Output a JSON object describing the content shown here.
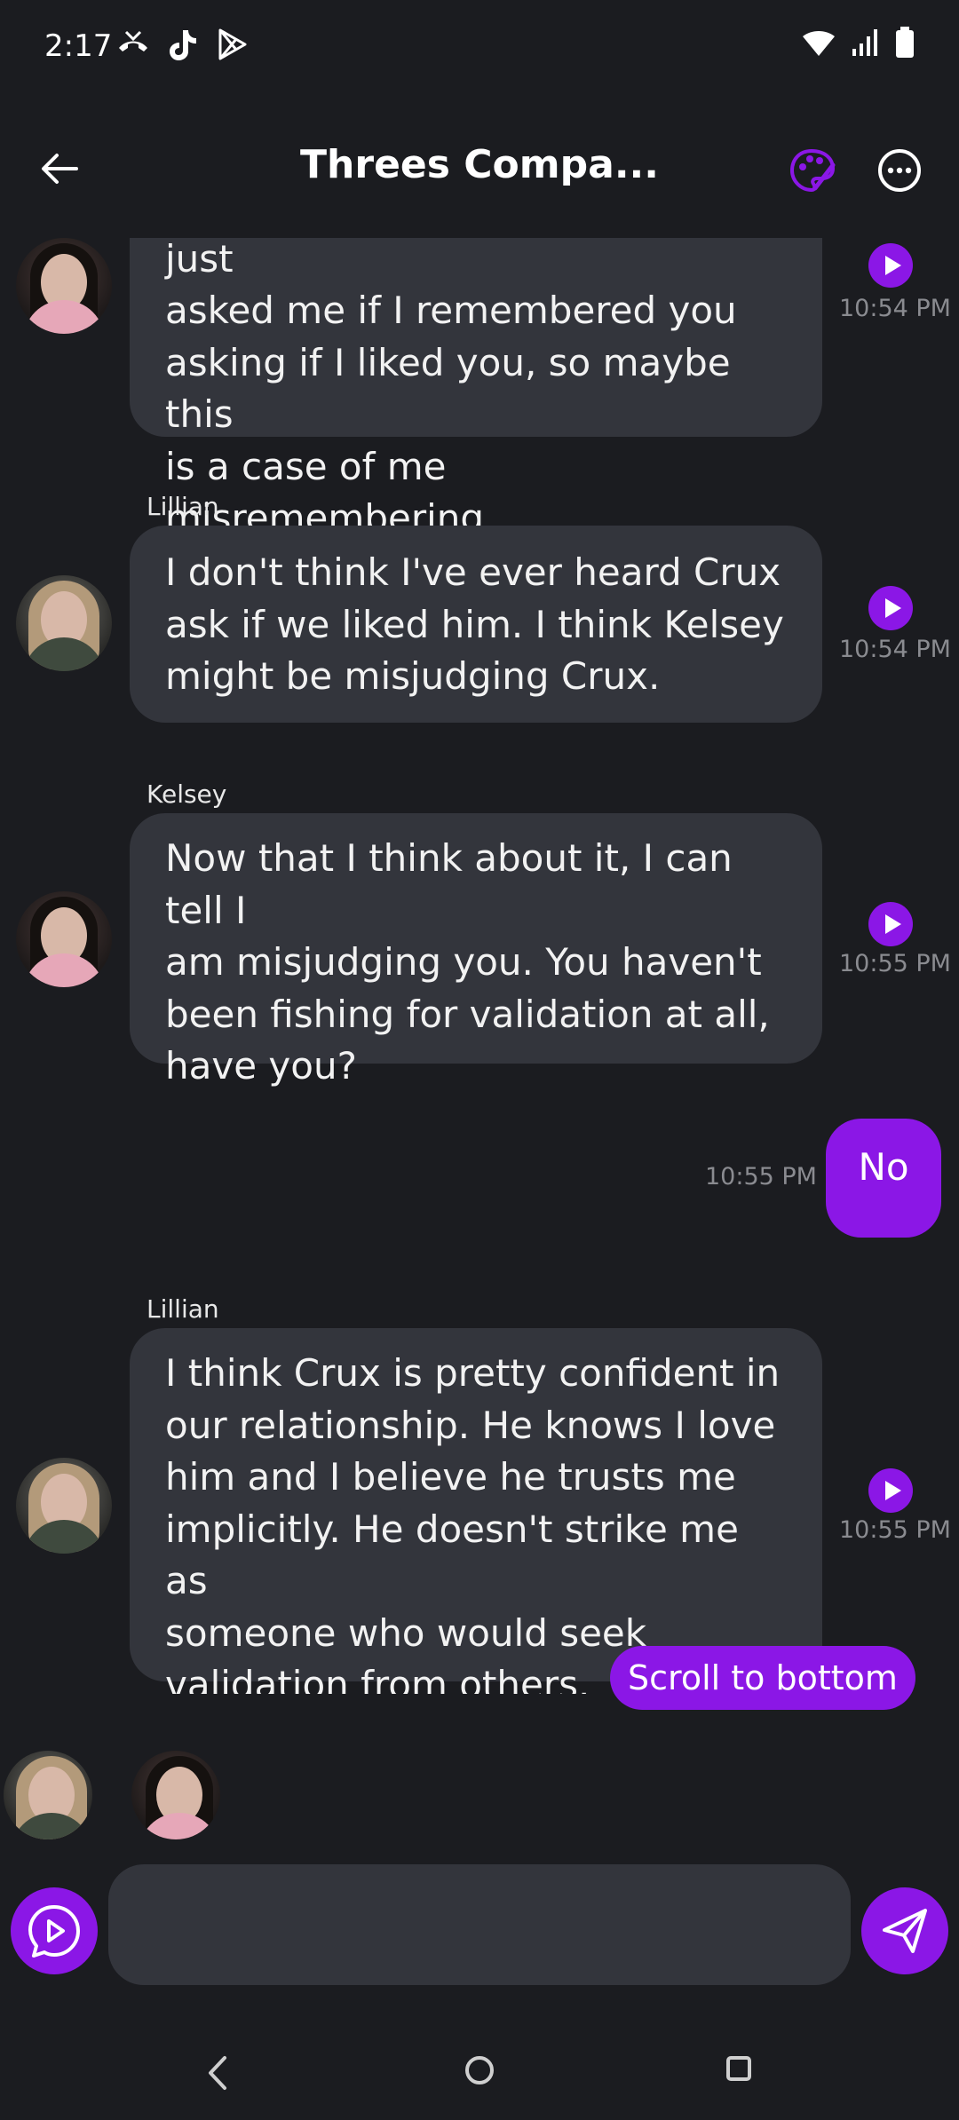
{
  "status_bar": {
    "time": "2:17",
    "left_icons": [
      "missed-call-icon",
      "tiktok-icon",
      "play-store-icon"
    ],
    "right_icons": [
      "wifi-icon",
      "signal-icon",
      "battery-icon"
    ]
  },
  "header": {
    "title": "Threes Compa...",
    "icons": [
      "back-arrow-icon",
      "palette-icon",
      "more-options-icon"
    ]
  },
  "colors": {
    "background": "#1b1c20",
    "bubble": "#33353c",
    "accent": "#8b17e6",
    "timestamp": "#8a8b90"
  },
  "messages": [
    {
      "sender": "",
      "avatar": "kelsey",
      "lines": [
        "realize I'm not sure. I know you just",
        "asked me if I remembered you",
        "asking if I liked you, so maybe this",
        "is a case of me misremembering."
      ],
      "time": "10:54 PM"
    },
    {
      "sender": "Lillian",
      "avatar": "lillian",
      "lines": [
        "I don't think I've ever heard Crux",
        "ask if we liked him. I think Kelsey",
        "might be misjudging Crux."
      ],
      "time": "10:54 PM"
    },
    {
      "sender": "Kelsey",
      "avatar": "kelsey",
      "lines": [
        "Now that I think about it, I can tell I",
        "am misjudging you. You haven't",
        "been fishing for validation at all,",
        "have you?"
      ],
      "time": "10:55 PM"
    },
    {
      "mine": true,
      "text": "No",
      "time": "10:55 PM"
    },
    {
      "sender": "Lillian",
      "avatar": "lillian",
      "lines": [
        "I think Crux is pretty confident in",
        "our relationship. He knows I love",
        "him and I believe he trusts me",
        "implicitly. He doesn't strike me as",
        "someone who would seek",
        "validation from others."
      ],
      "time": "10:55 PM"
    }
  ],
  "scroll_button": "Scroll to bottom",
  "typing_avatars": [
    "lillian",
    "kelsey"
  ],
  "composer": {
    "input_value": "",
    "placeholder": "",
    "icons": [
      "voice-message-icon",
      "send-icon"
    ]
  },
  "nav_bar": {
    "icons": [
      "nav-back-icon",
      "nav-home-icon",
      "nav-recents-icon"
    ]
  }
}
